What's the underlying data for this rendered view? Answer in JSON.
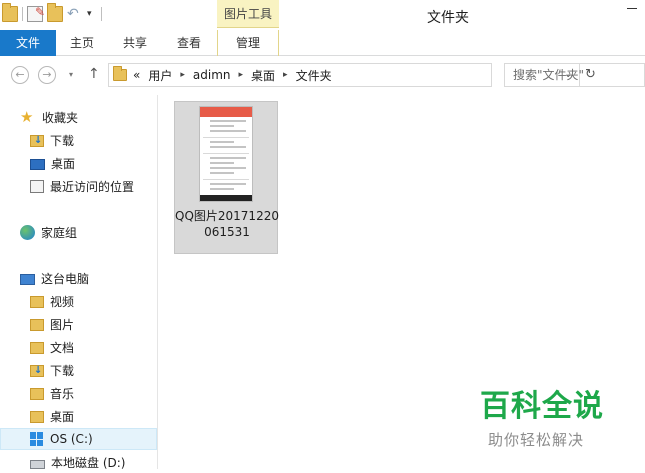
{
  "window": {
    "title": "文件夹",
    "context_tab": "图片工具"
  },
  "ribbon": {
    "tabs": [
      "文件",
      "主页",
      "共享",
      "查看",
      "管理"
    ]
  },
  "address": {
    "crumbs": [
      "«",
      "用户",
      "adimn",
      "桌面",
      "文件夹"
    ],
    "search_placeholder": "搜索\"文件夹\""
  },
  "sidebar": {
    "favorites": {
      "label": "收藏夹",
      "items": [
        "下载",
        "桌面",
        "最近访问的位置"
      ]
    },
    "homegroup": "家庭组",
    "this_pc": {
      "label": "这台电脑",
      "items": [
        "视频",
        "图片",
        "文档",
        "下载",
        "音乐",
        "桌面",
        "OS (C:)",
        "本地磁盘 (D:)"
      ]
    }
  },
  "files": [
    {
      "name": "QQ图片20171220061531"
    }
  ],
  "watermark": {
    "main": "百科全说",
    "sub": "助你轻松解决"
  },
  "colors": {
    "accent": "#1979ca",
    "context_tab": "#f9f3c2",
    "watermark": "#1ea84a"
  }
}
